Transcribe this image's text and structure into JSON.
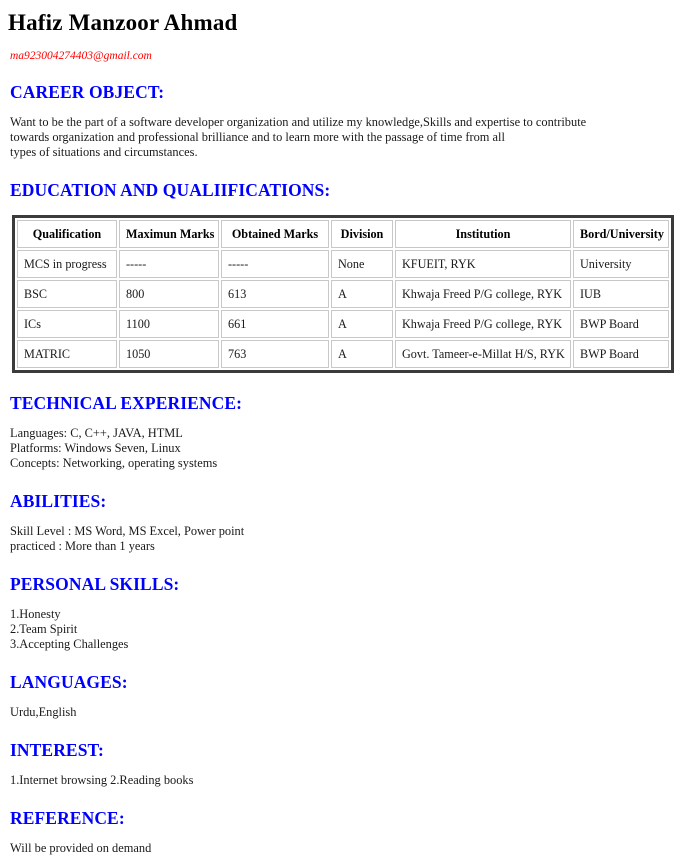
{
  "header": {
    "name": "Hafiz Manzoor Ahmad",
    "email": "ma923004274403@gmail.com",
    "name_color": "#000000",
    "email_color": "#ff0000",
    "heading_color": "#0000ff"
  },
  "sections": {
    "career": {
      "heading": "CAREER OBJECT:",
      "lines": [
        "Want to be the part of a software developer organization and utilize my knowledge,Skills and expertise to contribute",
        "towards organization and professional brilliance and to learn more with the passage of time from all",
        "types of situations and circumstances."
      ]
    },
    "education": {
      "heading": "EDUCATION AND QUALIIFICATIONS:",
      "columns": [
        "Qualification",
        "Maximun Marks",
        "Obtained Marks",
        "Division",
        "Institution",
        "Bord/University"
      ],
      "rows": [
        [
          "MCS in progress",
          "-----",
          "-----",
          "None",
          "KFUEIT, RYK",
          "University"
        ],
        [
          "BSC",
          "800",
          "613",
          "A",
          "Khwaja Freed P/G college, RYK",
          "IUB"
        ],
        [
          "ICs",
          "1100",
          "661",
          "A",
          "Khwaja Freed P/G college, RYK",
          "BWP Board"
        ],
        [
          "MATRIC",
          "1050",
          "763",
          "A",
          "Govt. Tameer-e-Millat H/S, RYK",
          "BWP Board"
        ]
      ]
    },
    "technical": {
      "heading": "TECHNICAL EXPERIENCE:",
      "lines": [
        "Languages: C, C++, JAVA, HTML",
        "Platforms: Windows Seven, Linux",
        "Concepts: Networking, operating systems"
      ]
    },
    "abilities": {
      "heading": "ABILITIES:",
      "lines": [
        "Skill Level : MS Word, MS Excel, Power point",
        "practiced : More than 1 years"
      ]
    },
    "personal_skills": {
      "heading": "PERSONAL SKILLS:",
      "lines": [
        "1.Honesty",
        "2.Team Spirit",
        "3.Accepting Challenges"
      ]
    },
    "languages": {
      "heading": "LANGUAGES:",
      "lines": [
        "Urdu,English"
      ]
    },
    "interest": {
      "heading": "INTEREST:",
      "lines": [
        "1.Internet browsing 2.Reading books"
      ]
    },
    "reference": {
      "heading": "REFERENCE:",
      "lines": [
        "Will be provided on demand"
      ]
    }
  }
}
